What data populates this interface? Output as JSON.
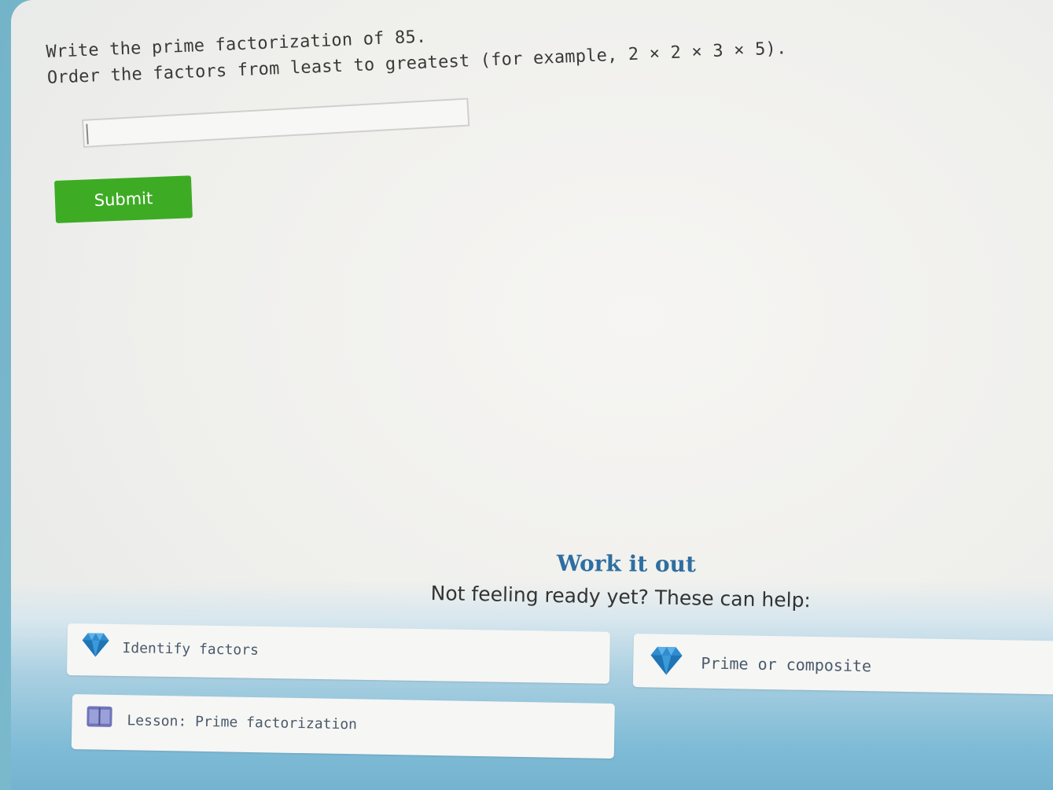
{
  "question": {
    "line1": "Write the prime factorization of 85.",
    "line2": "Order the factors from least to greatest (for example, 2 × 2 × 3 × 5)."
  },
  "answer": {
    "value": ""
  },
  "submit": {
    "label": "Submit"
  },
  "help": {
    "title": "Work it out",
    "subtitle": "Not feeling ready yet? These can help:",
    "items": [
      {
        "label": "Identify factors",
        "icon": "diamond-icon"
      },
      {
        "label": "Prime or composite",
        "icon": "diamond-icon"
      },
      {
        "label": "Lesson: Prime factorization",
        "icon": "lesson-icon"
      }
    ]
  },
  "colors": {
    "submit": "#3eab25",
    "title": "#2f6ea0",
    "diamond": "#2f8ccf"
  }
}
